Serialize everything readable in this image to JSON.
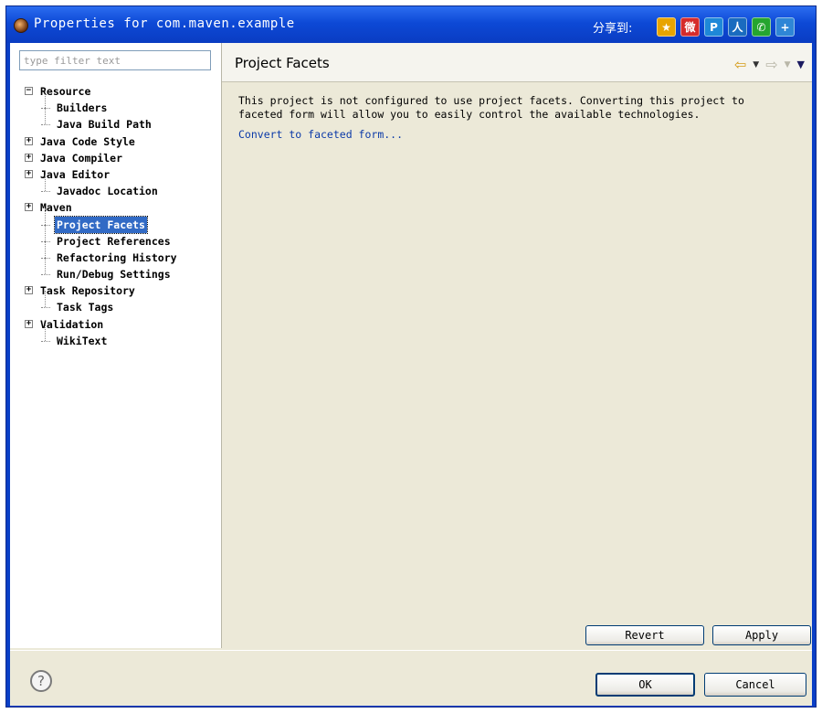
{
  "window": {
    "title": "Properties for com.maven.example"
  },
  "share": {
    "label": "分享到:",
    "icons": [
      {
        "name": "qzone-icon",
        "glyph": "★",
        "color": "#e8a400"
      },
      {
        "name": "weibo-icon",
        "glyph": "微",
        "color": "#d62b2b"
      },
      {
        "name": "pengyou-icon",
        "glyph": "P",
        "color": "#1e88d8"
      },
      {
        "name": "renren-icon",
        "glyph": "人",
        "color": "#1a6bbf"
      },
      {
        "name": "wechat-icon",
        "glyph": "✆",
        "color": "#25a52f"
      },
      {
        "name": "more-icon",
        "glyph": "+",
        "color": "#2f86d6"
      }
    ]
  },
  "filter": {
    "placeholder": "type filter text"
  },
  "tree": [
    {
      "label": "Resource",
      "expander": "⊟",
      "level": 0
    },
    {
      "label": "Builders",
      "level": 1
    },
    {
      "label": "Java Build Path",
      "level": 1
    },
    {
      "label": "Java Code Style",
      "expander": "⊞",
      "level": 0
    },
    {
      "label": "Java Compiler",
      "expander": "⊞",
      "level": 0
    },
    {
      "label": "Java Editor",
      "expander": "⊞",
      "level": 0
    },
    {
      "label": "Javadoc Location",
      "level": 1
    },
    {
      "label": "Maven",
      "expander": "⊞",
      "level": 0
    },
    {
      "label": "Project Facets",
      "level": 1,
      "selected": true
    },
    {
      "label": "Project References",
      "level": 1
    },
    {
      "label": "Refactoring History",
      "level": 1
    },
    {
      "label": "Run/Debug Settings",
      "level": 1
    },
    {
      "label": "Task Repository",
      "expander": "⊞",
      "level": 0
    },
    {
      "label": "Task Tags",
      "level": 1
    },
    {
      "label": "Validation",
      "expander": "⊞",
      "level": 0
    },
    {
      "label": "WikiText",
      "level": 1
    }
  ],
  "page": {
    "title": "Project Facets",
    "description": "This project is not configured to use project facets. Converting this project to faceted form will allow you to easily control the available technologies.",
    "convert_link": "Convert to faceted form...",
    "revert_label": "Revert",
    "apply_label": "Apply"
  },
  "footer": {
    "ok_label": "OK",
    "cancel_label": "Cancel",
    "help_glyph": "?"
  }
}
